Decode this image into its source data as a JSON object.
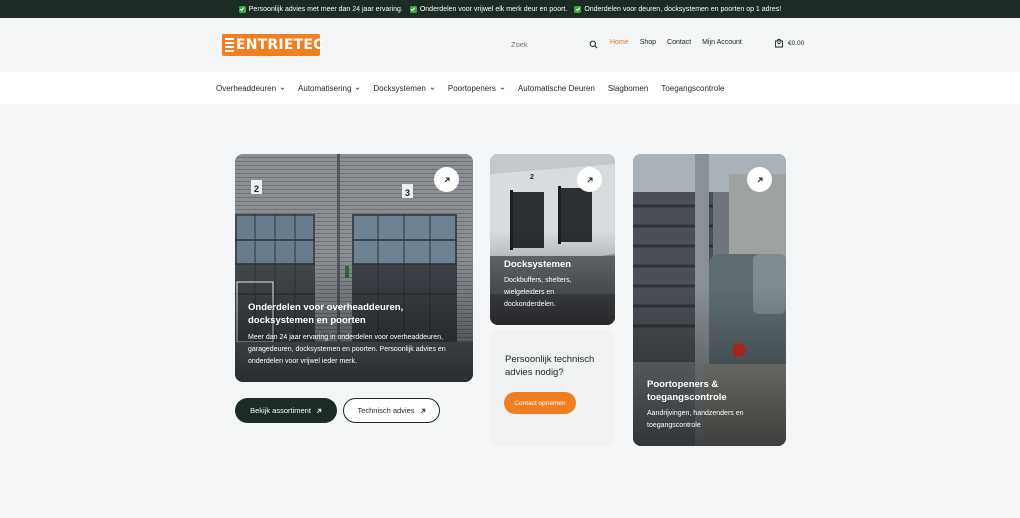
{
  "topbar": {
    "usps": [
      "Persoonlijk advies met meer dan 24 jaar ervaring.",
      "Onderdelen voor vrijwel elk merk deur en poort.",
      "Onderdelen voor deuren, docksystemen en poorten op 1 adres!"
    ]
  },
  "header": {
    "logo_text": "ENTRIETEC",
    "search_placeholder": "Zoek",
    "nav": [
      "Home",
      "Shop",
      "Contact",
      "Mijn Account"
    ],
    "cart_total": "€0.00"
  },
  "mainnav": {
    "items": [
      {
        "label": "Overheaddeuren",
        "has_dropdown": true
      },
      {
        "label": "Automatisering",
        "has_dropdown": true
      },
      {
        "label": "Docksystemen",
        "has_dropdown": true
      },
      {
        "label": "Poortopeners",
        "has_dropdown": true
      },
      {
        "label": "Automatische Deuren",
        "has_dropdown": false
      },
      {
        "label": "Slagbomen",
        "has_dropdown": false
      },
      {
        "label": "Toegangscontrole",
        "has_dropdown": false
      }
    ]
  },
  "hero": {
    "title": "Onderdelen voor overheaddeuren, docksystemen en poorten",
    "text": "Meer dan 24 jaar ervaring in onderdelen voor overheaddeuren, garagedeuren, docksystemen en poorten. Persoonlijk advies en onderdelen voor vrijwel ieder merk.",
    "door_numbers": [
      "2",
      "3"
    ]
  },
  "dock": {
    "title": "Docksystemen",
    "text": "Dockbuffers, shelters, wielgeleiders en dockonderdelen.",
    "door_number": "2"
  },
  "advice": {
    "title": "Persoonlijk technisch advies nodig?",
    "button": "Contact opnemen"
  },
  "gates": {
    "title": "Poortopeners & toegangscontrole",
    "text": "Aandrijvingen, handzenders en toegangscontrole"
  },
  "buttons": {
    "assortment": "Bekijk assortiment",
    "technical": "Technisch advies"
  },
  "colors": {
    "brand_orange": "#f07f22",
    "dark_green": "#1c2b24",
    "active_link": "#e8762c"
  }
}
